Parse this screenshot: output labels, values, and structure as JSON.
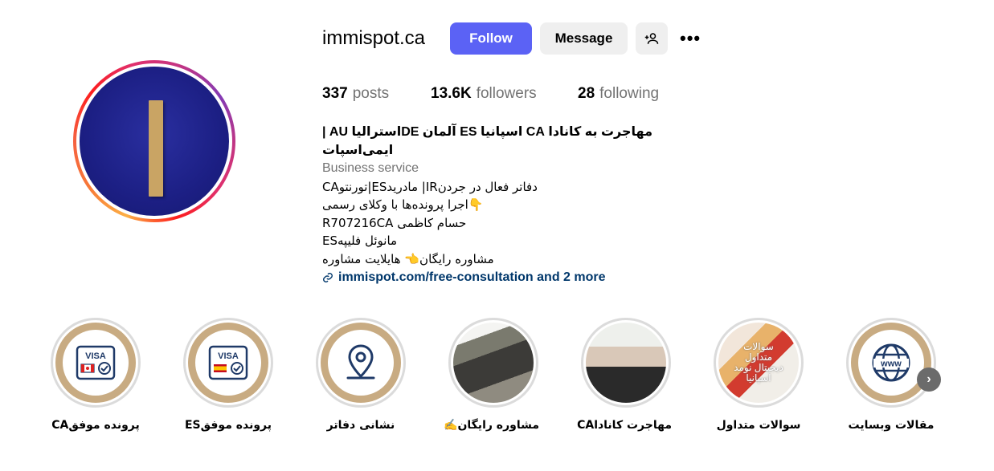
{
  "profile": {
    "username": "immispot.ca",
    "follow_label": "Follow",
    "message_label": "Message",
    "more_label": "•••"
  },
  "stats": {
    "posts_count": "337",
    "posts_label": "posts",
    "followers_count": "13.6K",
    "followers_label": "followers",
    "following_count": "28",
    "following_label": "following"
  },
  "bio": {
    "name": "مهاجرت به کانادا CA اسپانیا ES آلمان DEاسترالیا AU | ایمی‌اسپات",
    "category": "Business service",
    "lines": [
      "دفاتر فعال در جردنIR| مادریدES|تورنتوCA",
      "👇اجرا پرونده‌ها با وکلای رسمی",
      "حسام کاظمی R707216CA",
      "ESمانوئل فلیپه",
      "مشاوره رایگان👈 هایلایت مشاوره"
    ],
    "link_text": "immispot.com/free-consultation and 2 more"
  },
  "highlights": [
    {
      "label": "پرونده موفقCA",
      "icon": "visa-canada-icon"
    },
    {
      "label": "پرونده موفقES",
      "icon": "visa-spain-icon"
    },
    {
      "label": "نشانی دفاتر",
      "icon": "map-pin-icon"
    },
    {
      "label": "مشاوره رایگان✍️",
      "icon": "photo-consultation"
    },
    {
      "label": "مهاجرت کاناداCA",
      "icon": "photo-woman"
    },
    {
      "label": "سوالات متداول",
      "icon": "photo-faq",
      "overlay_text": "سوالات متداول دیجیتال نومد اسپانیا"
    },
    {
      "label": "مقالات وبسایت",
      "icon": "www-globe-icon"
    }
  ],
  "visa_text": "VISA",
  "colors": {
    "follow": "#5b62f5",
    "link": "#00376b",
    "highlight_ring": "#c8ab82",
    "avatar_bg": "#1c1f84"
  }
}
